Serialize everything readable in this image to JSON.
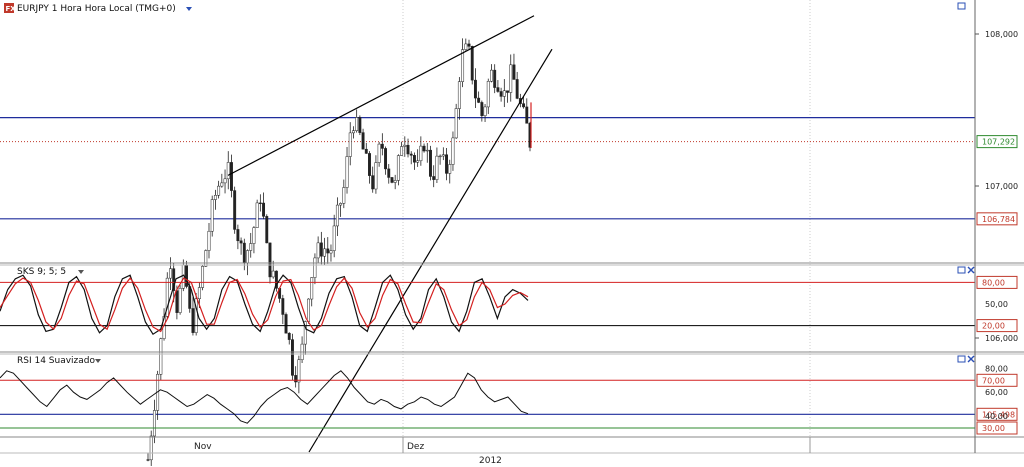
{
  "window": {
    "title": "EURJPY 1 Hora Hora Local (TMG+0)",
    "symbol_icon": "fx-icon",
    "dropdown_icon": "triangle-down-icon"
  },
  "colors": {
    "hline": "#1f2d9c",
    "dotted": "#c0392b",
    "candle": "#222222",
    "osc_red": "#d42020",
    "osc_black": "#111111",
    "rsi_green": "#2f8a2f",
    "tag_green": "#2f8a2f",
    "tag_red": "#c0392b",
    "icon_blue": "#2a4fb5",
    "grid": "#cccccc"
  },
  "chart_data": [
    {
      "type": "candlestick",
      "name": "price",
      "yaxis": {
        "ticks": [
          108.0,
          107.0,
          106.0
        ]
      },
      "ytick_labels": [
        "108,000",
        "107,000",
        "106,000"
      ],
      "current_price": {
        "value": 107.292,
        "label": "107,292"
      },
      "horizontal_lines": [
        {
          "value": 107.45,
          "label": ""
        },
        {
          "value": 106.784,
          "label": "106,784"
        },
        {
          "value": 105.498,
          "label": "105,498"
        }
      ],
      "trendlines": [
        {
          "from": [
            "bar",
            5,
            107.07
          ],
          "to": [
            "bar",
            72,
            108.12
          ]
        },
        {
          "from": [
            "bar",
            33,
            105.25
          ],
          "to": [
            "bar",
            117,
            107.9
          ]
        }
      ],
      "x_labels": [
        "Nov",
        "Dez"
      ],
      "x_bottom_label": "2012",
      "close_path": [
        [
          0,
          105.2
        ],
        [
          3,
          105.85
        ],
        [
          6,
          106.55
        ],
        [
          8,
          106.2
        ],
        [
          10,
          106.45
        ],
        [
          12,
          106.05
        ],
        [
          14,
          106.3
        ],
        [
          16,
          106.6
        ],
        [
          18,
          106.9
        ],
        [
          20,
          107.05
        ],
        [
          22,
          107.1
        ],
        [
          24,
          106.75
        ],
        [
          26,
          106.55
        ],
        [
          28,
          106.6
        ],
        [
          31,
          106.95
        ],
        [
          33,
          106.5
        ],
        [
          35,
          106.35
        ],
        [
          37,
          106.2
        ],
        [
          39,
          105.95
        ],
        [
          40,
          105.75
        ],
        [
          42,
          105.85
        ],
        [
          44,
          106.3
        ],
        [
          46,
          106.55
        ],
        [
          48,
          106.6
        ],
        [
          50,
          106.55
        ],
        [
          52,
          106.8
        ],
        [
          54,
          107.0
        ],
        [
          56,
          107.45
        ],
        [
          58,
          107.35
        ],
        [
          60,
          107.15
        ],
        [
          62,
          107.0
        ],
        [
          64,
          107.3
        ],
        [
          66,
          107.1
        ],
        [
          68,
          107.0
        ],
        [
          70,
          107.35
        ],
        [
          72,
          107.25
        ],
        [
          74,
          107.1
        ],
        [
          76,
          107.3
        ],
        [
          78,
          107.05
        ],
        [
          80,
          107.2
        ],
        [
          82,
          107.1
        ],
        [
          84,
          107.3
        ],
        [
          86,
          107.85
        ],
        [
          88,
          107.9
        ],
        [
          90,
          107.6
        ],
        [
          92,
          107.45
        ],
        [
          94,
          107.75
        ],
        [
          96,
          107.7
        ],
        [
          98,
          107.6
        ],
        [
          100,
          107.75
        ],
        [
          102,
          107.55
        ],
        [
          104,
          107.4
        ],
        [
          105,
          107.29
        ]
      ]
    },
    {
      "type": "line",
      "name": "stochastic",
      "title": "SKS 9; 5; 5",
      "ytick_labels": [
        "80,00",
        "50,00",
        "20,00"
      ],
      "yaxis": {
        "min": 0,
        "max": 100,
        "ticks": [
          80,
          50,
          20
        ]
      },
      "levels": [
        80,
        20
      ],
      "series": [
        {
          "name": "",
          "color": "osc_black",
          "values": [
            40,
            70,
            85,
            90,
            75,
            35,
            12,
            15,
            45,
            80,
            88,
            70,
            30,
            10,
            20,
            60,
            85,
            90,
            60,
            25,
            8,
            15,
            50,
            85,
            90,
            70,
            30,
            15,
            30,
            70,
            88,
            82,
            50,
            22,
            12,
            40,
            75,
            90,
            80,
            45,
            15,
            10,
            30,
            65,
            85,
            88,
            60,
            20,
            12,
            45,
            80,
            90,
            70,
            35,
            15,
            30,
            70,
            85,
            60,
            25,
            12,
            40,
            80,
            85,
            60,
            30,
            60,
            70,
            65,
            55
          ]
        },
        {
          "name": "",
          "color": "osc_red",
          "values": [
            45,
            62,
            78,
            86,
            80,
            55,
            25,
            15,
            30,
            62,
            82,
            78,
            50,
            22,
            15,
            42,
            72,
            86,
            72,
            42,
            18,
            12,
            32,
            68,
            86,
            80,
            50,
            22,
            22,
            52,
            80,
            84,
            64,
            36,
            18,
            28,
            60,
            82,
            84,
            62,
            30,
            14,
            20,
            48,
            74,
            86,
            72,
            38,
            18,
            30,
            62,
            84,
            78,
            50,
            25,
            24,
            52,
            78,
            70,
            42,
            20,
            28,
            60,
            80,
            70,
            45,
            50,
            62,
            66,
            60
          ]
        }
      ]
    },
    {
      "type": "line",
      "name": "rsi",
      "title": "RSI 14 Suavizado",
      "ytick_labels": [
        "80,00",
        "60,00",
        "40,00"
      ],
      "yaxis": {
        "min": 30,
        "max": 82,
        "ticks": [
          80,
          60,
          40
        ]
      },
      "levels": [
        {
          "value": 70,
          "label": "70,00",
          "color": "osc_red"
        },
        {
          "value": 30,
          "label": "30,00",
          "color": "rsi_green"
        }
      ],
      "series": [
        {
          "name": "",
          "color": "osc_black",
          "values": [
            72,
            78,
            76,
            70,
            64,
            58,
            52,
            48,
            55,
            62,
            66,
            60,
            56,
            54,
            58,
            62,
            68,
            72,
            66,
            60,
            55,
            50,
            54,
            58,
            62,
            60,
            56,
            52,
            48,
            50,
            54,
            58,
            55,
            50,
            46,
            42,
            36,
            34,
            40,
            48,
            54,
            58,
            62,
            64,
            60,
            54,
            50,
            56,
            62,
            68,
            74,
            78,
            72,
            64,
            58,
            52,
            50,
            54,
            52,
            48,
            46,
            50,
            52,
            56,
            54,
            50,
            48,
            52,
            56,
            66,
            76,
            72,
            62,
            56,
            52,
            54,
            56,
            50,
            44,
            42
          ]
        }
      ]
    }
  ],
  "bottom_axis": {
    "labels": [
      "Nov",
      "Dez"
    ],
    "year": "2012"
  },
  "icons": [
    "restore-icon",
    "close-icon"
  ]
}
